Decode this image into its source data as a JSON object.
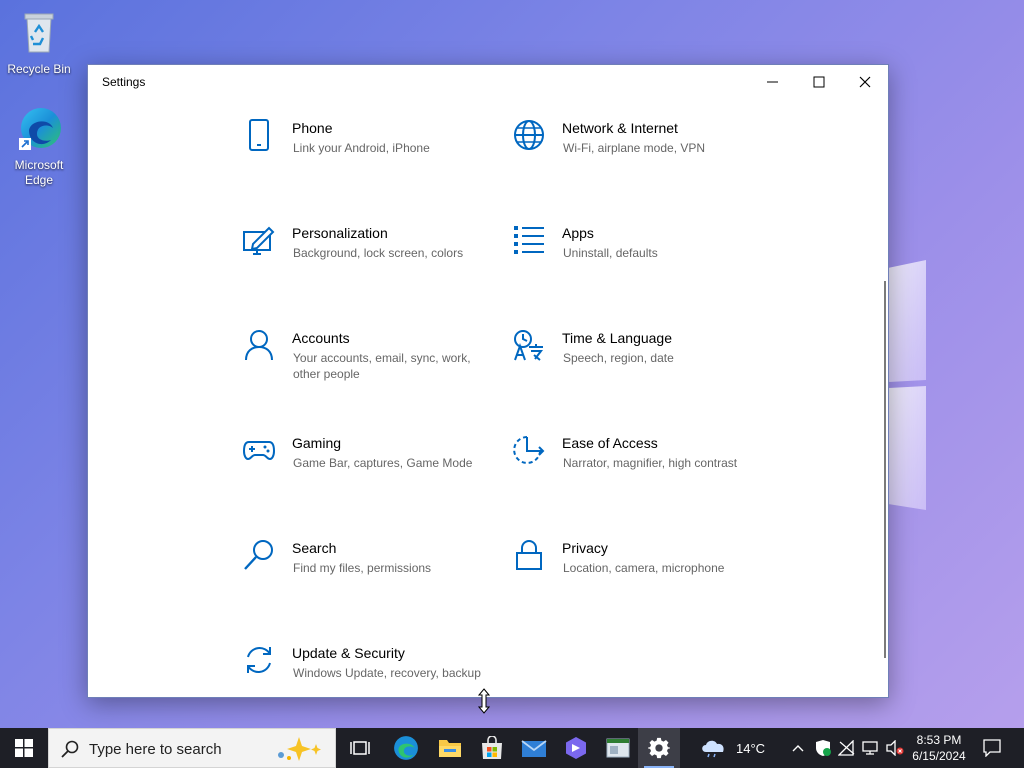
{
  "desktop": {
    "icons": [
      {
        "label": "Recycle Bin"
      },
      {
        "label": "Microsoft Edge"
      }
    ]
  },
  "window": {
    "title": "Settings",
    "tiles": [
      {
        "icon": "phone-icon",
        "name": "Phone",
        "desc": "Link your Android, iPhone"
      },
      {
        "icon": "globe-icon",
        "name": "Network & Internet",
        "desc": "Wi-Fi, airplane mode, VPN"
      },
      {
        "icon": "personalization-icon",
        "name": "Personalization",
        "desc": "Background, lock screen, colors"
      },
      {
        "icon": "apps-list-icon",
        "name": "Apps",
        "desc": "Uninstall, defaults"
      },
      {
        "icon": "person-icon",
        "name": "Accounts",
        "desc": "Your accounts, email, sync, work, other people"
      },
      {
        "icon": "time-language-icon",
        "name": "Time & Language",
        "desc": "Speech, region, date"
      },
      {
        "icon": "gamepad-icon",
        "name": "Gaming",
        "desc": "Game Bar, captures, Game Mode"
      },
      {
        "icon": "ease-of-access-icon",
        "name": "Ease of Access",
        "desc": "Narrator, magnifier, high contrast"
      },
      {
        "icon": "search-icon",
        "name": "Search",
        "desc": "Find my files, permissions"
      },
      {
        "icon": "lock-icon",
        "name": "Privacy",
        "desc": "Location, camera, microphone"
      },
      {
        "icon": "refresh-icon",
        "name": "Update & Security",
        "desc": "Windows Update, recovery, backup"
      }
    ]
  },
  "taskbar": {
    "search_placeholder": "Type here to search",
    "weather_temp": "14°C",
    "time": "8:53 PM",
    "date": "6/15/2024"
  },
  "colors": {
    "accent": "#0067c0",
    "taskbar": "#1e1f26"
  }
}
